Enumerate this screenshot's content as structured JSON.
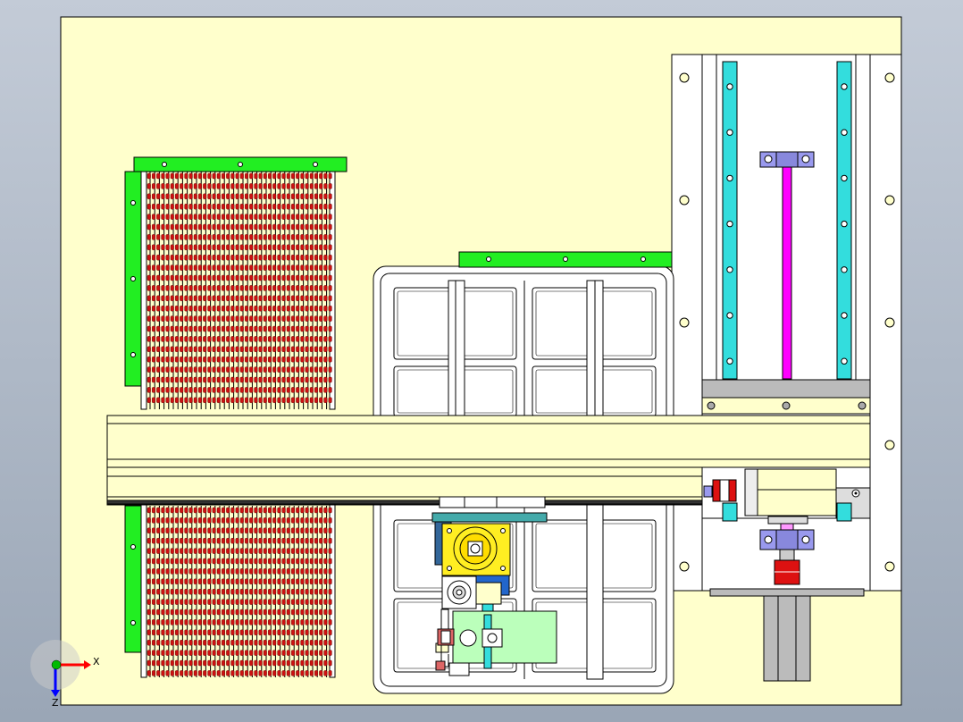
{
  "viewport": {
    "background_top": "#c3cbd7",
    "background_bottom": "#9aa6b6",
    "sheet_color": "#ffffcc"
  },
  "colors": {
    "green_bracket": "#22ee22",
    "coil_red": "#cc1111",
    "rail_cyan": "#33dddd",
    "screw_magenta": "#ff00ff",
    "block_lavender": "#9999ee",
    "motor_yellow": "#ffee22",
    "mount_teal": "#44aaaa",
    "panel_mint": "#bbffbb",
    "frame_gray": "#bbbbbb",
    "outline": "#000000"
  },
  "triad": {
    "x_label": "X",
    "z_label": "Z",
    "x_color": "#ff0000",
    "z_color": "#0000ff",
    "origin_color": "#00bb00"
  }
}
